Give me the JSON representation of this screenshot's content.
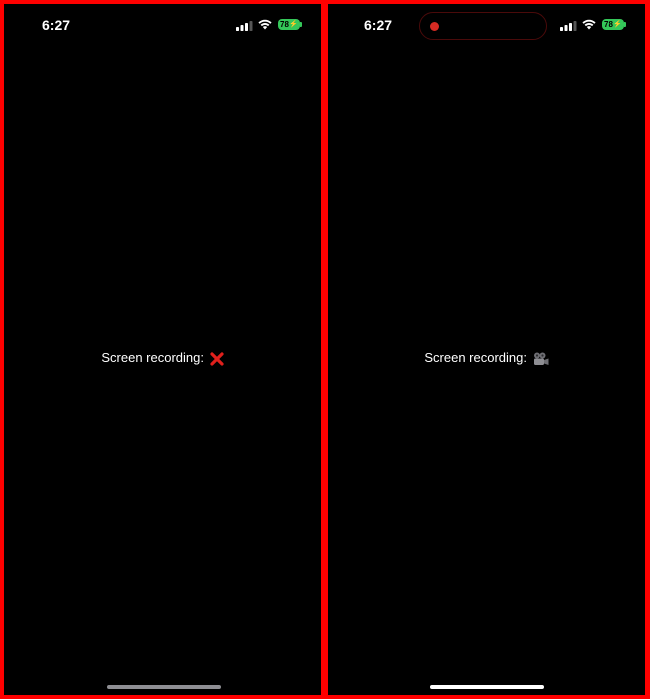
{
  "left_screen": {
    "time": "6:27",
    "battery": "78",
    "label": "Screen recording:",
    "status_icon": "cross-mark-icon",
    "recording": false
  },
  "right_screen": {
    "time": "6:27",
    "battery": "78",
    "label": "Screen recording:",
    "status_icon": "video-camera-icon",
    "recording": true
  },
  "colors": {
    "frame": "#ff0000",
    "background": "#000000",
    "battery": "#34c759",
    "recording_dot": "#d62b23",
    "cross": "#e0201c"
  }
}
